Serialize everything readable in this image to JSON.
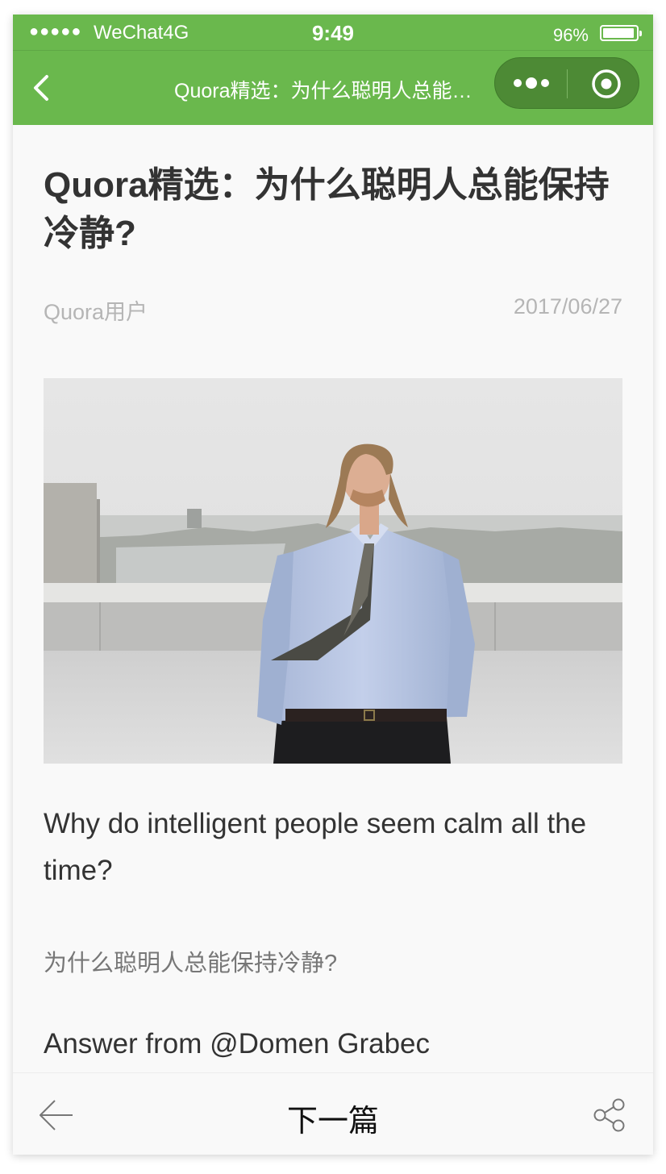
{
  "status_bar": {
    "signal": "●●●●●",
    "carrier": "WeChat4G",
    "time": "9:49",
    "battery_pct": "96%",
    "battery_level": 0.96
  },
  "nav": {
    "title": "Quora精选：为什么聪明人总能保持冷静?",
    "back_icon": "chevron-left-icon",
    "more_icon": "more-dots-icon",
    "close_icon": "target-close-icon"
  },
  "article": {
    "title": "Quora精选：为什么聪明人总能保持冷静?",
    "author": "Quora用户",
    "date": "2017/06/27",
    "paragraph_en": "Why do intelligent people seem calm all the time?",
    "paragraph_zh": "为什么聪明人总能保持冷静?",
    "answer_line": "Answer from @Domen Grabec"
  },
  "bottom_bar": {
    "back_icon": "arrow-left-icon",
    "next_label": "下一篇",
    "share_icon": "share-icon"
  },
  "colors": {
    "brand_green": "#6ab84d",
    "capsule_green": "#4d8a35"
  }
}
